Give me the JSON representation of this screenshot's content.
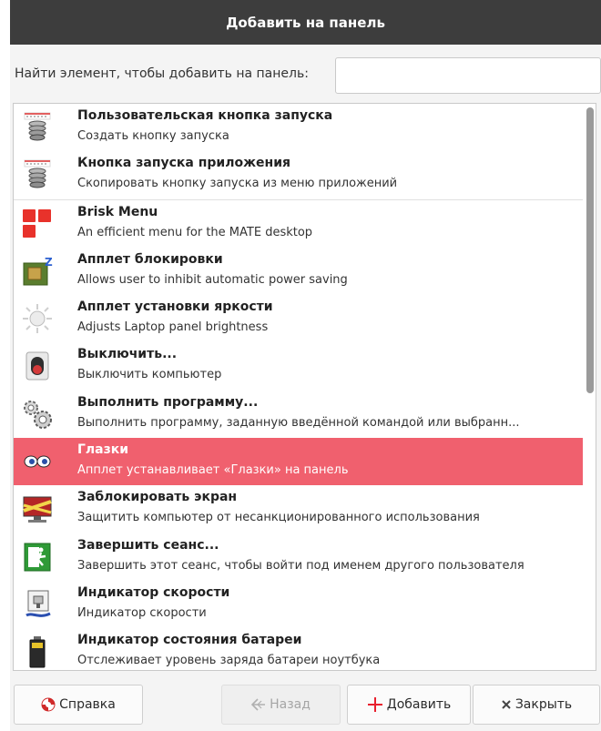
{
  "window": {
    "title": "Добавить на панель"
  },
  "search": {
    "label": "Найти элемент, чтобы добавить на панель:",
    "value": "",
    "placeholder": ""
  },
  "items": [
    {
      "name": "Пользовательская кнопка запуска",
      "desc": "Создать кнопку запуска",
      "icon": "launcher-spring-icon"
    },
    {
      "name": "Кнопка запуска приложения",
      "desc": "Скопировать кнопку запуска из меню приложений",
      "icon": "launcher-spring-icon"
    },
    {
      "name": "Brisk Menu",
      "desc": "An efficient menu for the MATE desktop",
      "icon": "brisk-menu-icon"
    },
    {
      "name": "Апплет блокировки",
      "desc": "Allows user to inhibit automatic power saving",
      "icon": "inhibit-chip-icon"
    },
    {
      "name": "Апплет установки яркости",
      "desc": "Adjusts Laptop panel brightness",
      "icon": "brightness-sun-icon"
    },
    {
      "name": "Выключить...",
      "desc": "Выключить компьютер",
      "icon": "power-switch-icon"
    },
    {
      "name": "Выполнить программу...",
      "desc": "Выполнить программу, заданную введённой командой или выбранн...",
      "icon": "run-gears-icon"
    },
    {
      "name": "Глазки",
      "desc": "Апплет устанавливает «Глазки» на панель",
      "icon": "eyes-icon",
      "selected": true
    },
    {
      "name": "Заблокировать экран",
      "desc": "Защитить компьютер от несанкционированного использования",
      "icon": "lock-screen-icon"
    },
    {
      "name": "Завершить сеанс...",
      "desc": "Завершить этот сеанс, чтобы войти под именем другого пользователя",
      "icon": "logout-exit-icon"
    },
    {
      "name": "Индикатор скорости",
      "desc": "Индикатор скорости",
      "icon": "netspeed-icon"
    },
    {
      "name": "Индикатор состояния батареи",
      "desc": "Отслеживает уровень заряда батареи ноутбука",
      "icon": "battery-icon"
    }
  ],
  "buttons": {
    "help": "Справка",
    "back": "Назад",
    "add": "Добавить",
    "close": "Закрыть"
  },
  "colors": {
    "titlebar": "#3d3d3d",
    "selection": "#f0606e",
    "add_icon": "#e8202e"
  }
}
